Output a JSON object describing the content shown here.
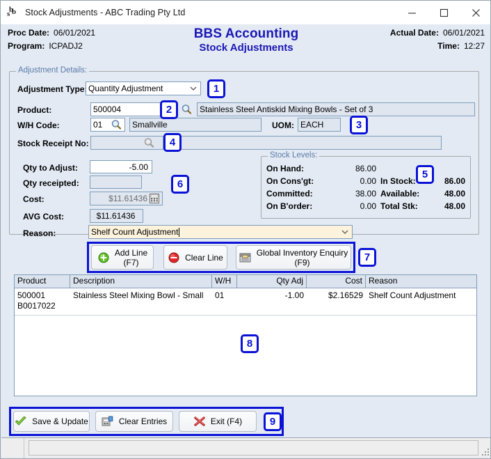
{
  "window": {
    "title": "Stock Adjustments - ABC Trading Pty Ltd",
    "app_icon": "bbs-monogram-icon",
    "minimize_label": "─",
    "maximize_label": "☐",
    "close_label": "✕"
  },
  "header": {
    "proc_date_label": "Proc Date:",
    "proc_date_value": "06/01/2021",
    "program_label": "Program:",
    "program_value": "ICPADJ2",
    "title_line1": "BBS Accounting",
    "title_line2": "Stock Adjustments",
    "actual_date_label": "Actual Date:",
    "actual_date_value": "06/01/2021",
    "time_label": "Time:",
    "time_value": "12:27"
  },
  "adjustment_details": {
    "group_title": "Adjustment Details:",
    "adjustment_type_label": "Adjustment Type:",
    "adjustment_type_value": "Quantity Adjustment",
    "product_label": "Product:",
    "product_code": "500004",
    "product_description": "Stainless Steel Antiskid Mixing Bowls - Set of 3",
    "wh_code_label": "W/H Code:",
    "wh_code_value": "01",
    "wh_name": "Smallville",
    "uom_label": "UOM:",
    "uom_value": "EACH",
    "stock_receipt_label": "Stock Receipt No:",
    "stock_receipt_value": "",
    "qty_to_adjust_label": "Qty to Adjust:",
    "qty_to_adjust_value": "-5.00",
    "qty_receipted_label": "Qty receipted:",
    "qty_receipted_value": "",
    "cost_label": "Cost:",
    "cost_value": "$11.61436",
    "avg_cost_label": "AVG Cost:",
    "avg_cost_value": "$11.61436",
    "reason_label": "Reason:",
    "reason_value": "Shelf Count Adjustment"
  },
  "stock_levels": {
    "group_title": "Stock Levels:",
    "rows": [
      {
        "label": "On Hand:",
        "value": "86.00",
        "label2": "",
        "value2": ""
      },
      {
        "label": "On Cons'gt:",
        "value": "0.00",
        "label2": "In Stock:",
        "value2": "86.00"
      },
      {
        "label": "Committed:",
        "value": "38.00",
        "label2": "Available:",
        "value2": "48.00"
      },
      {
        "label": "On B'order:",
        "value": "0.00",
        "label2": "Total Stk:",
        "value2": "48.00"
      }
    ]
  },
  "line_actions": {
    "add_line_line1": "Add Line",
    "add_line_line2": "(F7)",
    "clear_line": "Clear Line",
    "global_enquiry_line1": "Global Inventory Enquiry",
    "global_enquiry_line2": "(F9)"
  },
  "grid": {
    "columns": [
      "Product",
      "Description",
      "W/H",
      "Qty Adj",
      "Cost",
      "Reason"
    ],
    "rows": [
      {
        "product": "500001",
        "product_line2": "B0017022",
        "description": "Stainless Steel Mixing Bowl - Small",
        "wh": "01",
        "qty_adj": "-1.00",
        "cost": "$2.16529",
        "reason": "Shelf Count Adjustment"
      }
    ]
  },
  "footer_actions": {
    "save_update": "Save & Update",
    "clear_entries": "Clear Entries",
    "exit": "Exit (F4)"
  },
  "callouts": [
    {
      "id": "1",
      "text": "1"
    },
    {
      "id": "2",
      "text": "2"
    },
    {
      "id": "3",
      "text": "3"
    },
    {
      "id": "4",
      "text": "4"
    },
    {
      "id": "5",
      "text": "5"
    },
    {
      "id": "6",
      "text": "6"
    },
    {
      "id": "7",
      "text": "7"
    },
    {
      "id": "8",
      "text": "8"
    },
    {
      "id": "9",
      "text": "9"
    }
  ],
  "colors": {
    "accent_blue": "#0a12d6",
    "title_blue": "#1b18b5",
    "window_bg": "#e3eaf4",
    "field_border": "#7f9db9",
    "group_title": "#5a7aa8"
  }
}
